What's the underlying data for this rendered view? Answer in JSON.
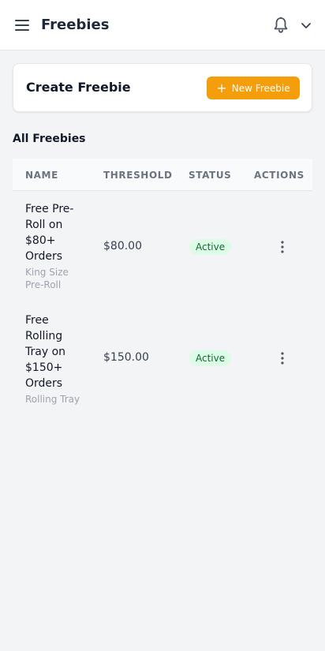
{
  "header": {
    "title": "Freebies",
    "menu_icon": "hamburger-menu-icon",
    "bell_icon": "bell-icon",
    "chevron_icon": "chevron-down-icon"
  },
  "create_card": {
    "title": "Create Freebie",
    "button_label": "New Freebie",
    "button_icon": "plus-icon"
  },
  "section": {
    "title": "All Freebies"
  },
  "table": {
    "columns": [
      "NAME",
      "THRESHOLD",
      "STATUS",
      "ACTIONS"
    ],
    "rows": [
      {
        "name": "Free Pre-Roll on $80+ Orders",
        "name_lines": [
          "Free Pre-",
          "Roll on",
          "$80+",
          "Orders"
        ],
        "product": "King Size Pre-Roll",
        "product_lines": [
          "King Size",
          "Pre-Roll"
        ],
        "threshold": "$80.00",
        "status": "Active"
      },
      {
        "name": "Free Rolling Tray on $150+ Orders",
        "name_lines": [
          "Free",
          "Rolling",
          "Tray on",
          "$150+",
          "Orders"
        ],
        "product": "Rolling Tray",
        "product_lines": [
          "Rolling Tray"
        ],
        "threshold": "$150.00",
        "status": "Active"
      }
    ]
  },
  "colors": {
    "accent": "#f59e0b",
    "background": "#f3f4f6",
    "status_active_bg": "#dcfce7",
    "status_active_text": "#166534"
  }
}
